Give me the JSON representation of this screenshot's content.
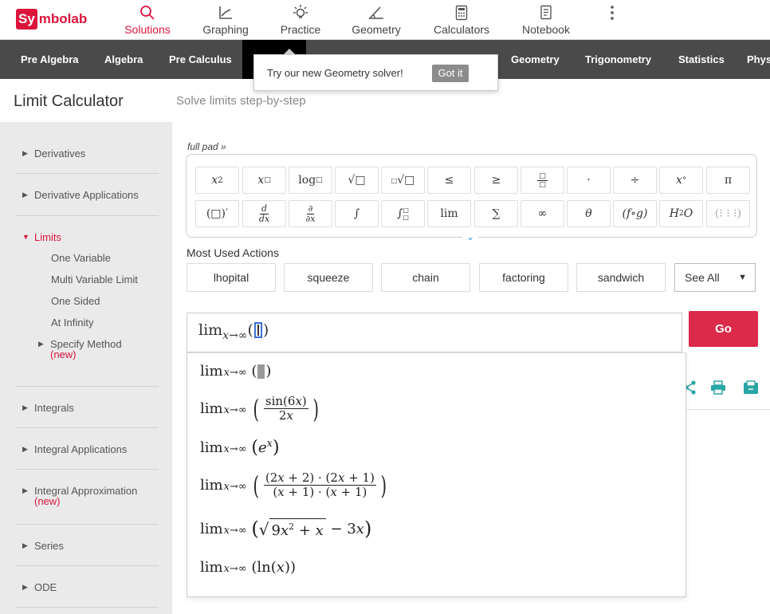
{
  "brand": {
    "logo_box": "Sy",
    "logo_rest": "mbolab",
    "color": "#dc143c"
  },
  "topnav": [
    {
      "label": "Solutions",
      "icon": "search-icon",
      "active": true
    },
    {
      "label": "Graphing",
      "icon": "graph-icon",
      "active": false
    },
    {
      "label": "Practice",
      "icon": "bulb-icon",
      "active": false
    },
    {
      "label": "Geometry",
      "icon": "angle-icon",
      "active": false
    },
    {
      "label": "Calculators",
      "icon": "calculator-icon",
      "active": false
    },
    {
      "label": "Notebook",
      "icon": "notebook-icon",
      "active": false
    }
  ],
  "subjects": [
    "Pre Algebra",
    "Algebra",
    "Pre Calculus",
    "Geometry",
    "Trigonometry",
    "Statistics",
    "Phys"
  ],
  "tooltip": {
    "text": "Try our new Geometry solver!",
    "button": "Got it"
  },
  "page": {
    "title": "Limit Calculator",
    "subtitle": "Solve limits step-by-step"
  },
  "sidebar": {
    "items": [
      {
        "label": "Derivatives"
      },
      {
        "label": "Derivative Applications"
      },
      {
        "label": "Limits"
      },
      {
        "label": "Integrals"
      },
      {
        "label": "Integral Applications"
      },
      {
        "label": "Integral Approximation",
        "badge": "(new)"
      },
      {
        "label": "Series"
      },
      {
        "label": "ODE"
      }
    ],
    "limit_subitems": [
      "One Variable",
      "Multi Variable Limit",
      "One Sided",
      "At Infinity"
    ],
    "specify_method": {
      "label": "Specify Method",
      "badge": "(new)"
    }
  },
  "keypad": {
    "full_pad_label": "full pad »"
  },
  "most_used": {
    "label": "Most Used Actions",
    "actions": [
      "lhopital",
      "squeeze",
      "chain",
      "factoring",
      "sandwich"
    ],
    "see_all": "See All"
  },
  "input": {
    "lim_text": "lim",
    "sub_text": "x→∞"
  },
  "go_button": "Go",
  "suggestions_count": 6
}
